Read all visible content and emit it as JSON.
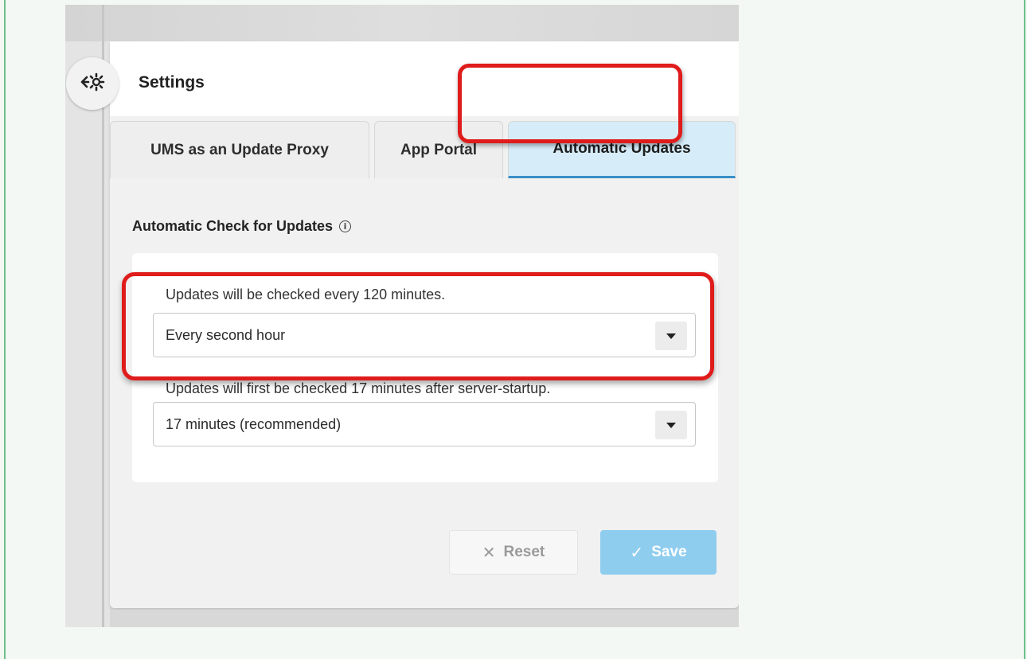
{
  "panel": {
    "title": "Settings"
  },
  "tabs": [
    {
      "label": "UMS as an Update Proxy",
      "active": false
    },
    {
      "label": "App Portal",
      "active": false
    },
    {
      "label": "Automatic Updates",
      "active": true
    }
  ],
  "section": {
    "title": "Automatic Check for Updates",
    "info_icon": "ⓘ"
  },
  "interval": {
    "label": "Updates will be checked every 120 minutes.",
    "value": "Every second hour"
  },
  "startup_delay": {
    "label": "Updates will first be checked 17 minutes after server-startup.",
    "value": "17 minutes (recommended)"
  },
  "actions": {
    "reset_icon": "✕",
    "reset_label": "Reset",
    "save_icon": "✓",
    "save_label": "Save"
  },
  "colors": {
    "highlight": "#e01b1b",
    "active_tab_bg": "#d6ecf8",
    "active_tab_border": "#3a8fc5",
    "save_button": "#8fcdef",
    "frame_border": "#6cc08a"
  },
  "icons": {
    "back": "back-settings-icon",
    "caret": "chevron-down-icon"
  }
}
